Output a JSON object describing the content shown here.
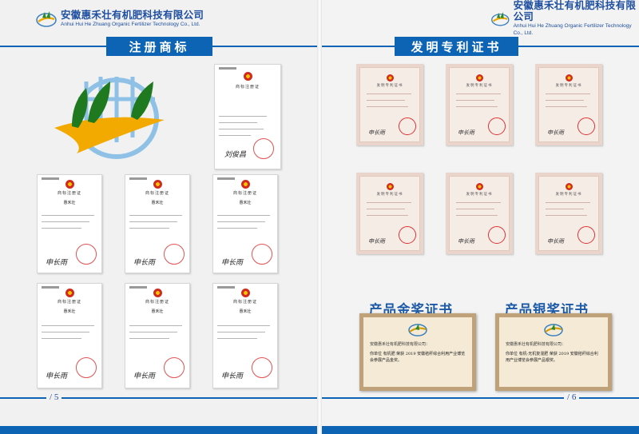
{
  "left_page": {
    "company_zh": "安徽惠禾壮有机肥科技有限公司",
    "company_en": "Anhui Hui He Zhuang Organic Fertilizer Technology Co., Ltd.",
    "section_title": "注册商标",
    "large_cert": {
      "title": "商标注册证",
      "signature": "刘俊昌"
    },
    "trademark_certs": [
      {
        "title": "商标注册证",
        "mark": "惠禾壮",
        "signature": "申长雨"
      },
      {
        "title": "商标注册证",
        "mark": "惠禾壮",
        "signature": "申长雨"
      },
      {
        "title": "商标注册证",
        "mark": "惠禾壮",
        "signature": "申长雨"
      },
      {
        "title": "商标注册证",
        "mark": "惠禾壮",
        "signature": "申长雨"
      },
      {
        "title": "商标注册证",
        "mark": "惠禾壮",
        "signature": "申长雨"
      },
      {
        "title": "商标注册证",
        "mark": "惠禾壮",
        "signature": "申长雨"
      }
    ],
    "page_number": "5"
  },
  "right_page": {
    "company_zh": "安徽惠禾壮有机肥科技有限公司",
    "company_en": "Anhui Hui He Zhuang Organic Fertilizer Technology Co., Ltd.",
    "section_title": "发明专利证书",
    "patents": [
      {
        "title": "发明专利证书",
        "signature": "申长雨"
      },
      {
        "title": "发明专利证书",
        "signature": "申长雨"
      },
      {
        "title": "发明专利证书",
        "signature": "申长雨"
      },
      {
        "title": "发明专利证书",
        "signature": "申长雨"
      },
      {
        "title": "发明专利证书",
        "signature": "申长雨"
      },
      {
        "title": "发明专利证书",
        "signature": "申长雨"
      }
    ],
    "gold_award": {
      "heading": "产品金奖证书",
      "company": "安徽惠禾壮有机肥科技有限公司：",
      "body": "你单位 有机肥 荣获 2019 安徽秸秆综合利用产业博览会参展产品金奖。"
    },
    "silver_award": {
      "heading": "产品银奖证书",
      "company": "安徽惠禾壮有机肥科技有限公司：",
      "body": "你单位 有机-无机复混肥 荣获 2019 安徽秸秆综合利用产业博览会参展产品银奖。"
    },
    "page_number": "6"
  },
  "colors": {
    "brand_blue": "#0d64b4",
    "title_blue": "#1c5aa8",
    "seal_red": "#d33"
  }
}
